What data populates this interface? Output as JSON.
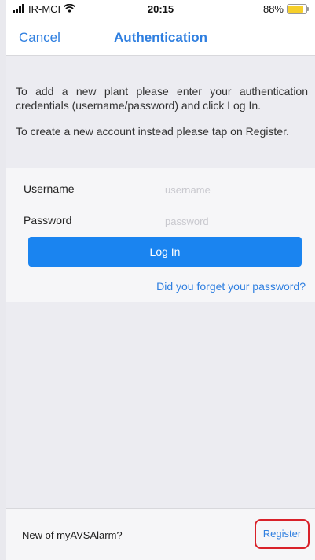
{
  "status_bar": {
    "carrier": "IR-MCI",
    "time": "20:15",
    "battery": "88%",
    "battery_level": 0.88,
    "icons": [
      "signal-icon",
      "wifi-icon",
      "battery-icon"
    ]
  },
  "nav": {
    "cancel_label": "Cancel",
    "title": "Authentication"
  },
  "intro": {
    "paragraph1": "To add a new plant please enter your authentication credentials (username/password) and click Log In.",
    "paragraph2": "To create a new account instead please tap on Register."
  },
  "form": {
    "username_label": "Username",
    "username_placeholder": "username",
    "username_value": "",
    "password_label": "Password",
    "password_placeholder": "password",
    "password_value": "",
    "login_label": "Log In",
    "forgot_label": "Did you forget your password?"
  },
  "footer": {
    "prompt": "New of myAVSAlarm?",
    "register_label": "Register"
  },
  "colors": {
    "accent": "#2f7fe0",
    "button": "#1a84f0",
    "highlight": "#d9222a",
    "battery": "#f6cf2a"
  }
}
